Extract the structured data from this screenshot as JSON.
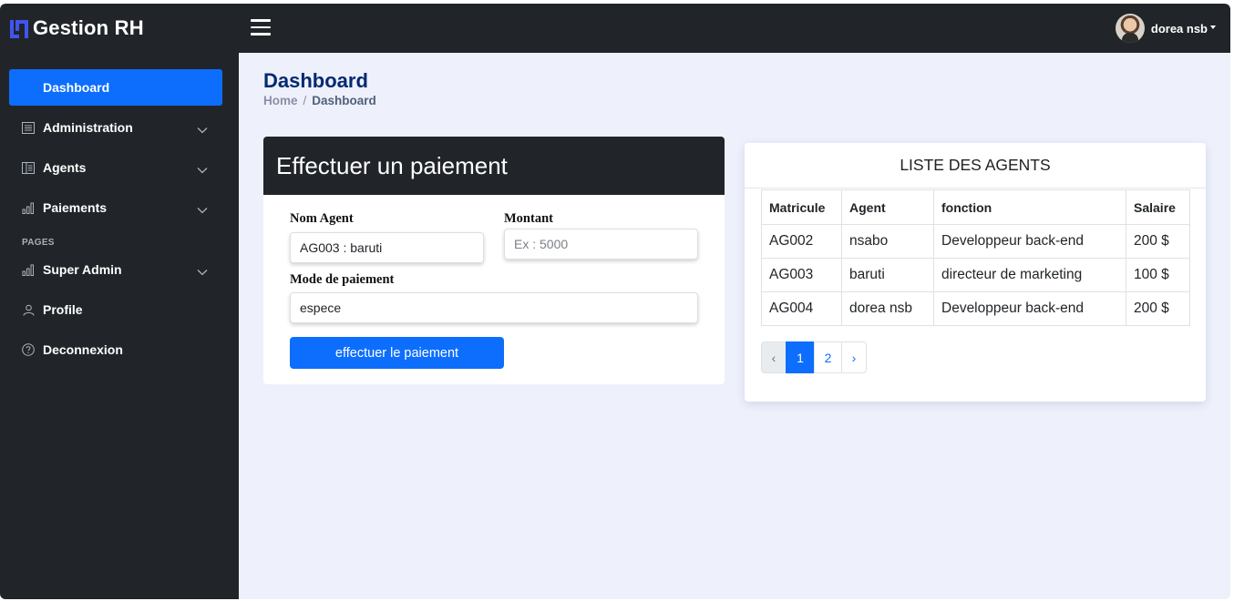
{
  "app": {
    "name": "Gestion RH"
  },
  "header": {
    "user_name": "dorea nsb"
  },
  "sidebar": {
    "items": [
      {
        "label": "Dashboard",
        "icon": "grid-icon",
        "active": true
      },
      {
        "label": "Administration",
        "icon": "menu-icon",
        "expandable": true
      },
      {
        "label": "Agents",
        "icon": "layout-text-icon",
        "expandable": true
      },
      {
        "label": "Paiements",
        "icon": "bar-chart-icon",
        "expandable": true
      }
    ],
    "pages_heading": "PAGES",
    "page_items": [
      {
        "label": "Super Admin",
        "icon": "bar-chart-icon",
        "expandable": true
      },
      {
        "label": "Profile",
        "icon": "person-icon"
      },
      {
        "label": "Deconnexion",
        "icon": "question-circle-icon"
      }
    ]
  },
  "main": {
    "title": "Dashboard",
    "breadcrumb": {
      "home": "Home",
      "separator": "/",
      "current": "Dashboard"
    }
  },
  "payment_form": {
    "title": "Effectuer un paiement",
    "agent_label": "Nom Agent",
    "agent_value": "AG003 : baruti",
    "amount_label": "Montant",
    "amount_placeholder": "Ex : 5000",
    "mode_label": "Mode de paiement",
    "mode_value": "espece",
    "submit_label": "effectuer le paiement"
  },
  "agents_list": {
    "title": "LISTE DES AGENTS",
    "columns": [
      "Matricule",
      "Agent",
      "fonction",
      "Salaire"
    ],
    "rows": [
      [
        "AG002",
        "nsabo",
        "Developpeur back-end",
        "200 $"
      ],
      [
        "AG003",
        "baruti",
        "directeur de marketing",
        "100 $"
      ],
      [
        "AG004",
        "dorea nsb",
        "Developpeur back-end",
        "200 $"
      ]
    ],
    "pagination": {
      "prev": "‹",
      "pages": [
        "1",
        "2"
      ],
      "current": "1",
      "next": "›"
    }
  },
  "colors": {
    "accent": "#0d6efd",
    "dark": "#212529",
    "title": "#012970",
    "background": "#eef0fb"
  }
}
